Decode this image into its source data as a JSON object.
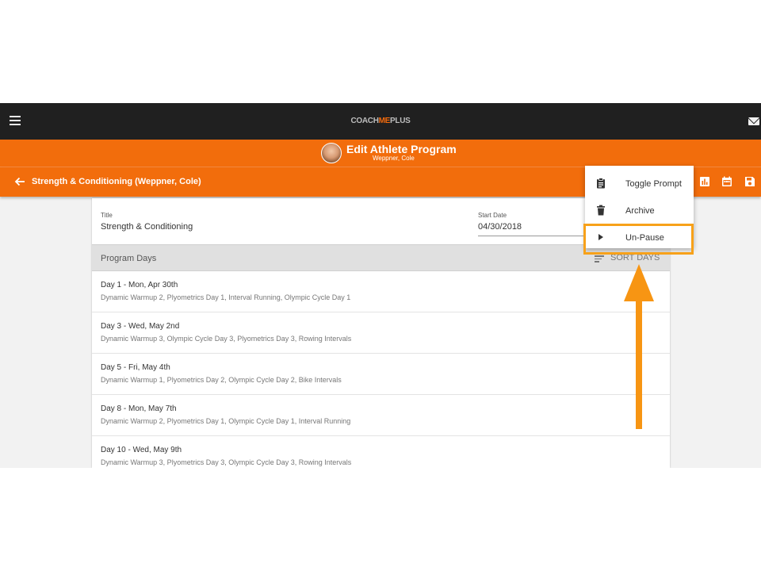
{
  "topbar": {
    "logo_left": "COACH",
    "logo_accent": "ME",
    "logo_right": "PLUS"
  },
  "header": {
    "title": "Edit Athlete Program",
    "subtitle": "Weppner, Cole"
  },
  "toolbar": {
    "program_name": "Strength & Conditioning (Weppner, Cole)"
  },
  "form": {
    "title_label": "Title",
    "title_value": "Strength & Conditioning",
    "start_date_label": "Start Date",
    "start_date_value": "04/30/2018"
  },
  "program_days": {
    "header": "Program Days",
    "sort_label": "SORT DAYS",
    "days": [
      {
        "title": "Day 1 - Mon, Apr 30th",
        "workouts": "Dynamic Warmup 2, Plyometrics Day 1, Interval Running, Olympic Cycle Day 1"
      },
      {
        "title": "Day 3 - Wed, May 2nd",
        "workouts": "Dynamic Warmup 3, Olympic Cycle Day 3, Plyometrics Day 3, Rowing Intervals"
      },
      {
        "title": "Day 5 - Fri, May 4th",
        "workouts": "Dynamic Warmup 1, Plyometrics Day 2, Olympic Cycle Day 2, Bike Intervals"
      },
      {
        "title": "Day 8 - Mon, May 7th",
        "workouts": "Dynamic Warmup 2, Plyometrics Day 1, Olympic Cycle Day 1, Interval Running"
      },
      {
        "title": "Day 10 - Wed, May 9th",
        "workouts": "Dynamic Warmup 3, Plyometrics Day 3, Olympic Cycle Day 3, Rowing Intervals"
      }
    ]
  },
  "menu": {
    "items": [
      {
        "label": "Toggle Prompt",
        "icon": "clipboard-icon"
      },
      {
        "label": "Archive",
        "icon": "trash-icon"
      },
      {
        "label": "Un-Pause",
        "icon": "play-icon"
      }
    ]
  },
  "colors": {
    "brand_orange": "#f26d0c",
    "topbar": "#202020",
    "callout": "#f7a11a"
  }
}
